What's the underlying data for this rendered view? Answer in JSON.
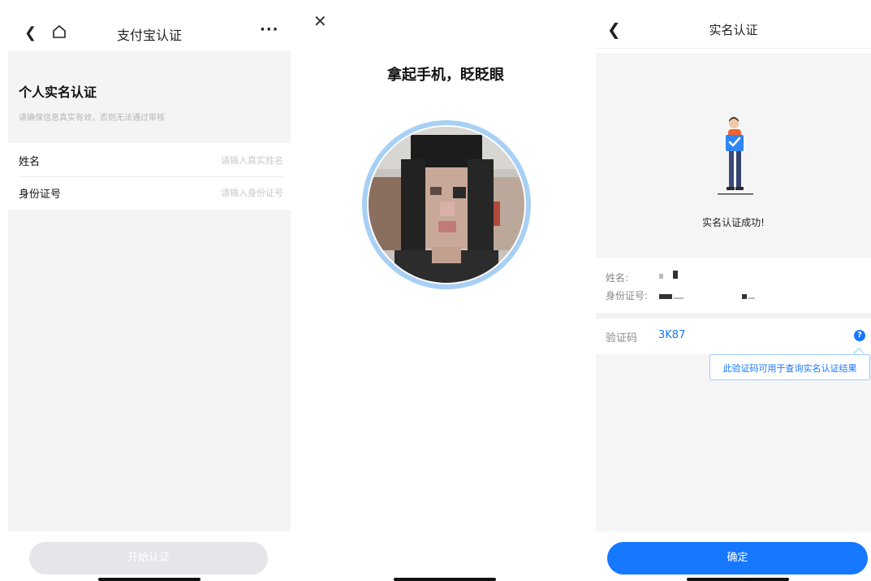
{
  "form_screen": {
    "nav_title": "支付宝认证",
    "back_icon": "chevron-left-icon",
    "home_icon": "home-icon",
    "more_icon": "more-icon",
    "more_glyph": "···",
    "section_title": "个人实名认证",
    "section_subtitle": "请确保信息真实有效，否则无法通过审核",
    "fields": [
      {
        "label": "姓名",
        "placeholder": "请输入真实姓名",
        "value": ""
      },
      {
        "label": "身份证号",
        "placeholder": "请输入身份证号",
        "value": ""
      }
    ],
    "start_button": "开始认证",
    "start_button_enabled": false
  },
  "face_screen": {
    "close_icon": "close-icon",
    "title": "拿起手机，眨眨眼",
    "face_image": "pixelated-face-photo"
  },
  "result_screen": {
    "nav_title": "实名认证",
    "back_icon": "chevron-left-icon",
    "illustration": "person-holding-check-card",
    "success_text": "实名认证成功!",
    "name_label": "姓名:",
    "id_label": "身份证号:",
    "code_label": "验证码",
    "code_value": "3K87",
    "help_icon": "question-circle-icon",
    "tooltip": "此验证码可用于查询实名认证结果",
    "confirm_button": "确定"
  },
  "colors": {
    "accent": "#1677ff",
    "page_gray": "#f4f4f4",
    "disabled_button": "#e4e6ea"
  }
}
